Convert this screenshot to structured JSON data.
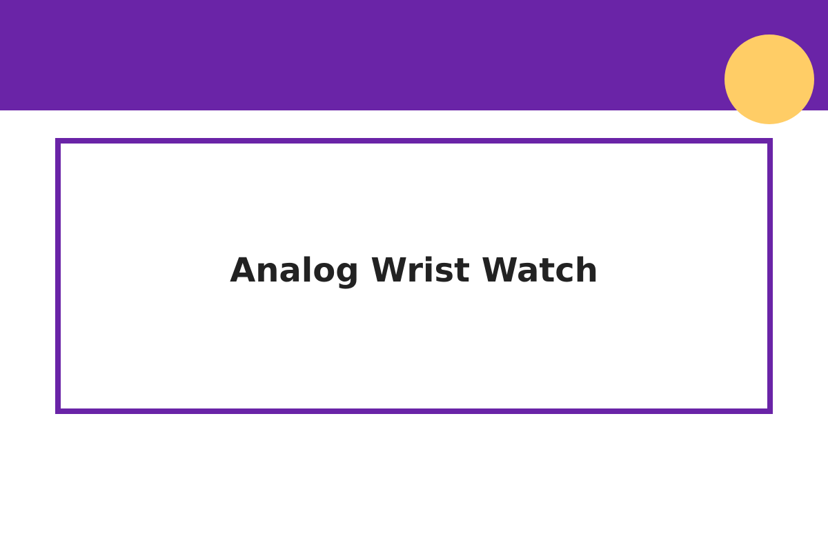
{
  "title": "Analog Wrist Watch",
  "colors": {
    "band": "#6a24a7",
    "frame": "#6a24a7",
    "accent_dot": "#ffcd66",
    "title_text": "#222222",
    "background": "#ffffff"
  }
}
